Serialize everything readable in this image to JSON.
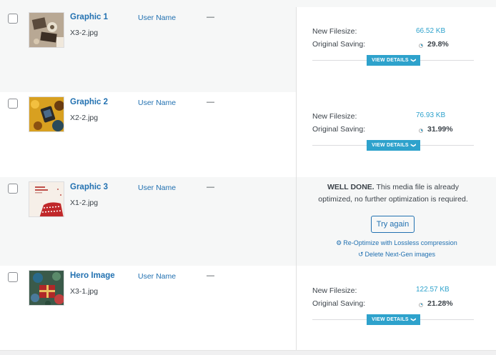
{
  "rows": [
    {
      "title": "Graphic 1",
      "filename": "X3-2.jpg",
      "author": "User Name",
      "dash": "—",
      "new_filesize_label": "New Filesize:",
      "new_filesize": "66.52 KB",
      "saving_label": "Original Saving:",
      "saving": "29.8%",
      "saving_fraction": 0.298,
      "view_details": "VIEW DETAILS"
    },
    {
      "title": "Graphic 2",
      "filename": "X2-2.jpg",
      "author": "User Name",
      "dash": "—",
      "new_filesize_label": "New Filesize:",
      "new_filesize": "76.93 KB",
      "saving_label": "Original Saving:",
      "saving": "31.99%",
      "saving_fraction": 0.3199,
      "view_details": "VIEW DETAILS"
    },
    {
      "title": "Graphic 3",
      "filename": "X1-2.jpg",
      "author": "User Name",
      "dash": "—",
      "message_bold": "WELL DONE.",
      "message_rest": "This media file is already optimized, no further optimization is required.",
      "try_again": "Try again",
      "reoptimize": "Re-Optimize with Lossless compression",
      "delete_nextgen": "Delete Next-Gen images"
    },
    {
      "title": "Hero Image",
      "filename": "X3-1.jpg",
      "author": "User Name",
      "dash": "—",
      "new_filesize_label": "New Filesize:",
      "new_filesize": "122.57 KB",
      "saving_label": "Original Saving:",
      "saving": "21.28%",
      "saving_fraction": 0.2128,
      "view_details": "VIEW DETAILS"
    }
  ],
  "colors": {
    "link": "#2271b1",
    "accent": "#2ea2cc",
    "row_alt": "#f6f7f7"
  },
  "icons": {
    "view_details": "chevron-down-icon",
    "reoptimize": "gear-icon",
    "delete_nextgen": "undo-icon"
  }
}
